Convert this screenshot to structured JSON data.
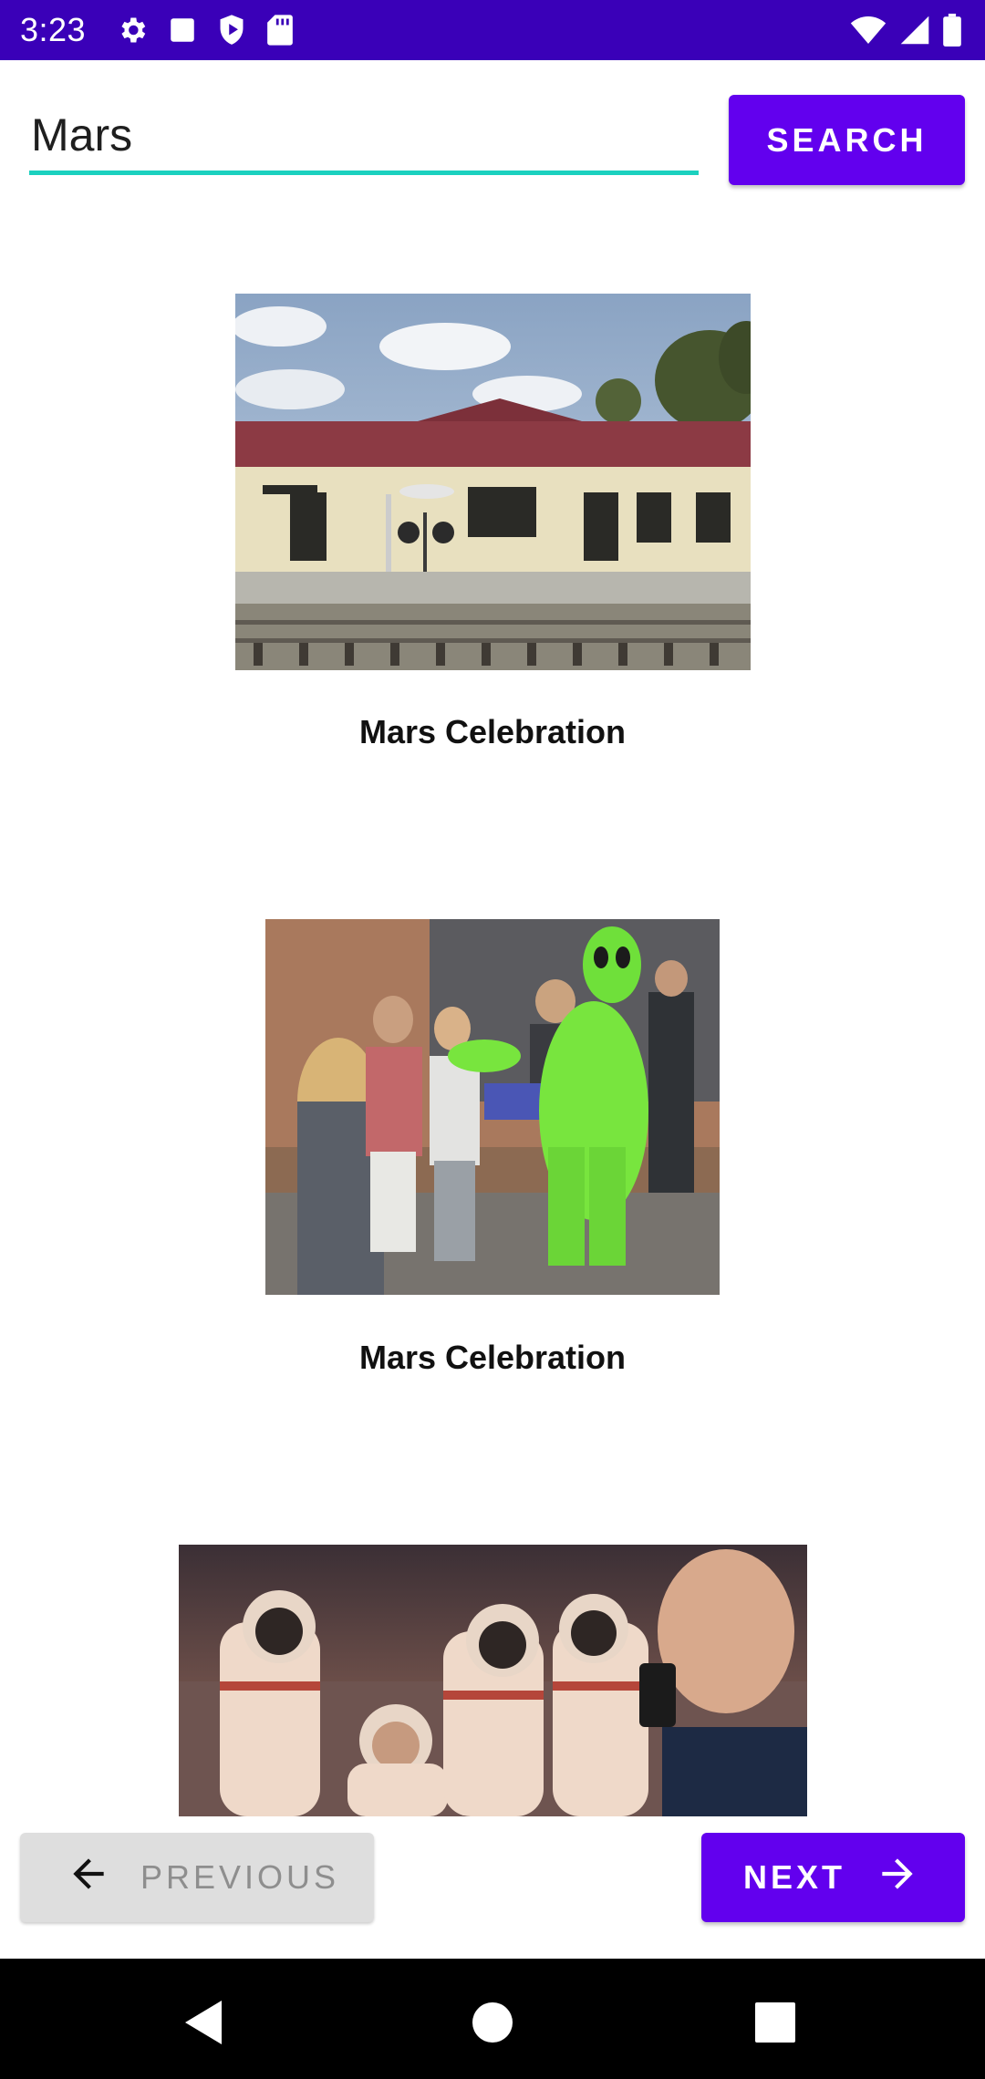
{
  "status_bar": {
    "time": "3:23",
    "left_icons": [
      "gear-icon",
      "square-icon",
      "play-shield-icon",
      "sd-card-icon"
    ],
    "right_icons": [
      "wifi-icon",
      "signal-icon",
      "battery-icon"
    ],
    "background": "#3a00b8"
  },
  "search": {
    "value": "Mars",
    "placeholder": "",
    "button_label": "SEARCH",
    "accent": "#1bd1bf"
  },
  "results": [
    {
      "title": "Mars Celebration",
      "image": "train-station-photo"
    },
    {
      "title": "Mars Celebration",
      "image": "alien-costume-crowd-photo"
    },
    {
      "title": "",
      "image": "astronaut-suits-photo"
    }
  ],
  "pagination": {
    "previous_label": "PREVIOUS",
    "next_label": "NEXT",
    "previous_enabled": false,
    "next_enabled": true
  },
  "nav_bar": {
    "buttons": [
      "back-icon",
      "home-icon",
      "recents-icon"
    ]
  },
  "colors": {
    "primary": "#6200ee",
    "disabled_bg": "#dedede",
    "disabled_text": "#8e8e8e"
  }
}
